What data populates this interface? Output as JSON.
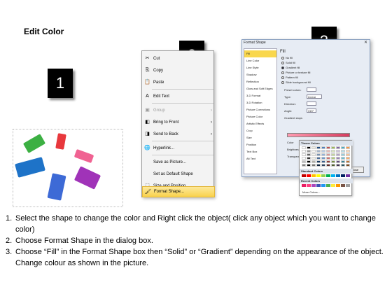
{
  "title": "Edit Color",
  "steps": {
    "one": "1",
    "two": "2",
    "three": "3"
  },
  "context_menu": {
    "items": [
      {
        "label": "Cut",
        "icon": "scissors-icon",
        "glyph": "✂"
      },
      {
        "label": "Copy",
        "icon": "copy-icon",
        "glyph": "⎘"
      },
      {
        "label": "Paste",
        "icon": "paste-icon",
        "glyph": "📋"
      },
      {
        "label": "Edit Text",
        "icon": "edit-text-icon",
        "glyph": "A"
      },
      {
        "label": "Group",
        "icon": "group-icon",
        "glyph": "▣"
      },
      {
        "label": "Bring to Front",
        "icon": "bring-front-icon",
        "glyph": "◧"
      },
      {
        "label": "Send to Back",
        "icon": "send-back-icon",
        "glyph": "◨"
      },
      {
        "label": "Hyperlink...",
        "icon": "hyperlink-icon",
        "glyph": "🌐"
      },
      {
        "label": "Save as Picture...",
        "icon": "",
        "glyph": ""
      },
      {
        "label": "Set as Default Shape",
        "icon": "",
        "glyph": ""
      },
      {
        "label": "Size and Position...",
        "icon": "size-position-icon",
        "glyph": "⬚"
      },
      {
        "label": "Format Shape...",
        "icon": "format-shape-icon",
        "glyph": "🖌"
      }
    ]
  },
  "dialog": {
    "title": "Format Shape",
    "close_glyph": "✕",
    "categories": [
      "Fill",
      "Line Color",
      "Line Style",
      "Shadow",
      "Reflection",
      "Glow and Soft Edges",
      "3-D Format",
      "3-D Rotation",
      "Picture Corrections",
      "Picture Color",
      "Artistic Effects",
      "Crop",
      "Size",
      "Position",
      "Text Box",
      "Alt Text"
    ],
    "fill_heading": "Fill",
    "options": [
      "No fill",
      "Solid fill",
      "Gradient fill",
      "Picture or texture fill",
      "Pattern fill",
      "Slide background fill"
    ],
    "selected_option": "Gradient fill",
    "preset_colors_label": "Preset colors:",
    "type_label": "Type:",
    "type_value": "Linear",
    "direction_label": "Direction:",
    "angle_label": "Angle:",
    "angle_value": "315°",
    "gradient_stops_label": "Gradient stops",
    "color_label": "Color",
    "position_label": "Position:",
    "position_value": "0%",
    "brightness_label": "Brightness",
    "transparency_label": "Transparen",
    "rotate_label": "Rotate",
    "close_label": "Close",
    "palette": {
      "theme_heading": "Theme Colors",
      "standard_heading": "Standard Colors",
      "recent_heading": "Recent Colors",
      "more_label": "More Colors...",
      "theme_colors": [
        "#ffffff",
        "#000000",
        "#eeece1",
        "#1f497d",
        "#4f81bd",
        "#c0504d",
        "#9bbb59",
        "#8064a2",
        "#4bacc6",
        "#f79646"
      ],
      "standard_colors": [
        "#c00000",
        "#ff0000",
        "#ffc000",
        "#ffff00",
        "#92d050",
        "#00b050",
        "#00b0f0",
        "#0070c0",
        "#002060",
        "#7030a0"
      ],
      "recent_colors": [
        "#e91e63",
        "#ff4081",
        "#ab47bc",
        "#3f51b5",
        "#2196f3",
        "#4caf50",
        "#ffeb3b",
        "#ff9800",
        "#795548",
        "#9e9e9e"
      ]
    }
  },
  "instructions": [
    {
      "num": "1.",
      "text": "Select the shape to change the color and Right click the object( click any object which you want to change color)"
    },
    {
      "num": "2.",
      "text": "Choose Format Shape in the dialog box."
    },
    {
      "num": "3.",
      "text": "Choose “Fill” in the Format Shape box then “Solid” or “Gradient” depending on the appearance of the object. Change colour as shown in the picture."
    }
  ]
}
